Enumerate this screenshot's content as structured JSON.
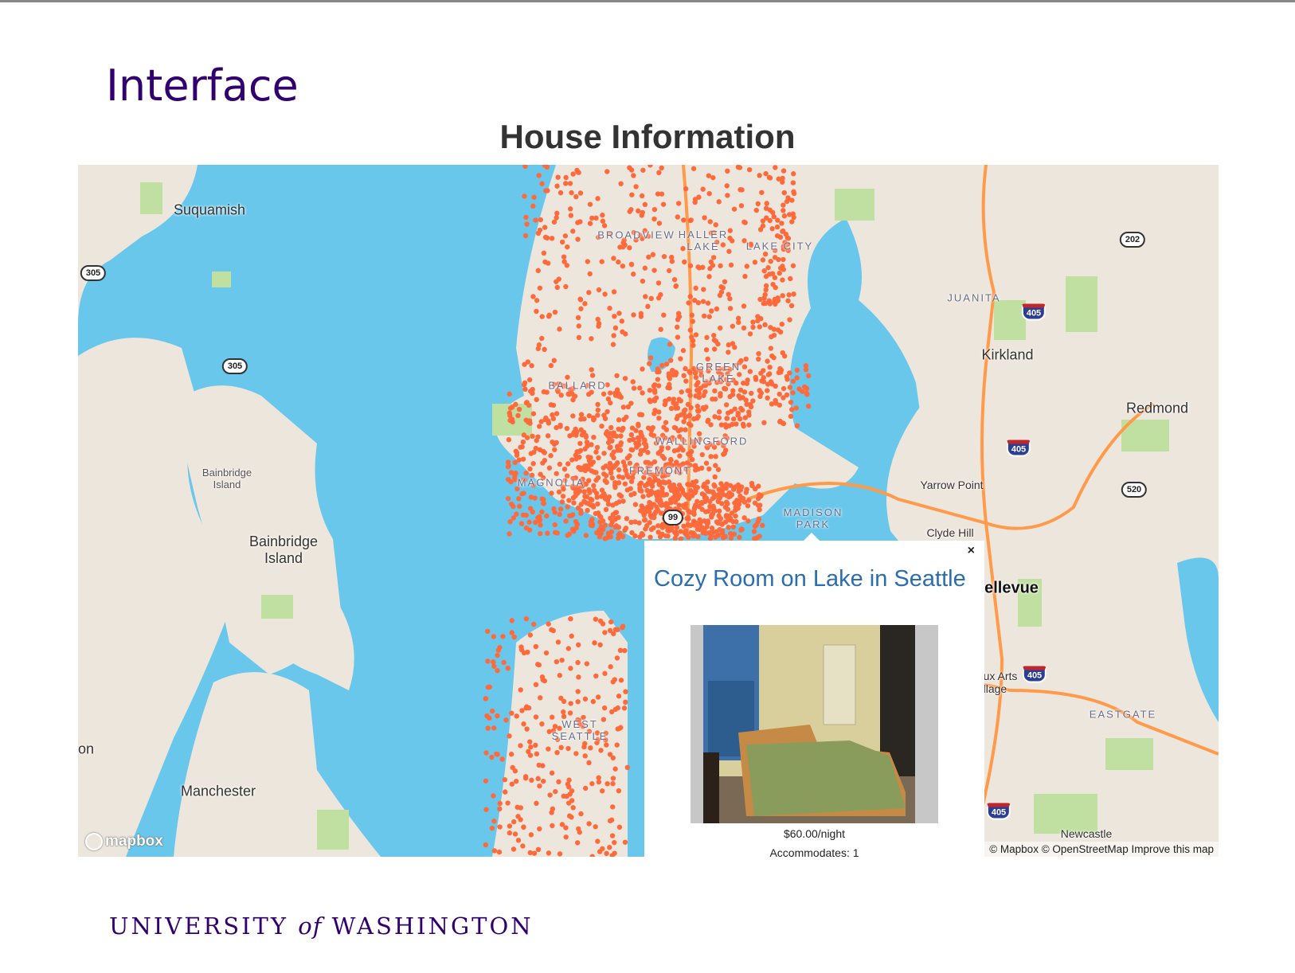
{
  "slide": {
    "title": "Interface",
    "footer": {
      "part1": "UNIVERSITY",
      "part2": "of",
      "part3": "WASHINGTON"
    }
  },
  "map": {
    "title": "House Information",
    "colors": {
      "water": "#69c7eb",
      "land": "#ede6dc",
      "park": "#bfe0a0",
      "listing_dot": "#ff6a3d",
      "highway": "#ff9a4a"
    },
    "labels": {
      "suquamish": "Suquamish",
      "bainbridge_small": "Bainbridge\nIsland",
      "bainbridge": "Bainbridge\nIsland",
      "manchester": "Manchester",
      "on": "on",
      "kirkland": "Kirkland",
      "redmond": "Redmond",
      "yarrow": "Yarrow Point",
      "clyde": "Clyde Hill",
      "bellevue": "ellevue",
      "juanita": "JUANITA",
      "eastgate": "EASTGATE",
      "newcastle": "Newcastle",
      "beaux": "ux Arts\nllage",
      "broadview": "BROADVIEW",
      "haller": "HALLER\nLAKE",
      "lakecity": "LAKE CITY",
      "ballard": "BALLARD",
      "greenlake": "GREEN\nLAKE",
      "wallingford": "WALLINGFORD",
      "fremont": "FREMONT",
      "magnolia": "MAGNOLIA",
      "madison": "MADISON\nPARK",
      "westseattle": "WEST\nSEATTLE"
    },
    "shields": {
      "s305a": "305",
      "s305b": "305",
      "s202": "202",
      "s520": "520",
      "s99": "99",
      "i405a": "405",
      "i405b": "405",
      "i405c": "405",
      "i405d": "405"
    },
    "logo": "mapbox",
    "attribution": "© Mapbox © OpenStreetMap Improve this map"
  },
  "popup": {
    "title": "Cozy Room on Lake in Seattle",
    "close": "×",
    "price": "$60.00/night",
    "accommodates": "Accommodates: 1"
  }
}
